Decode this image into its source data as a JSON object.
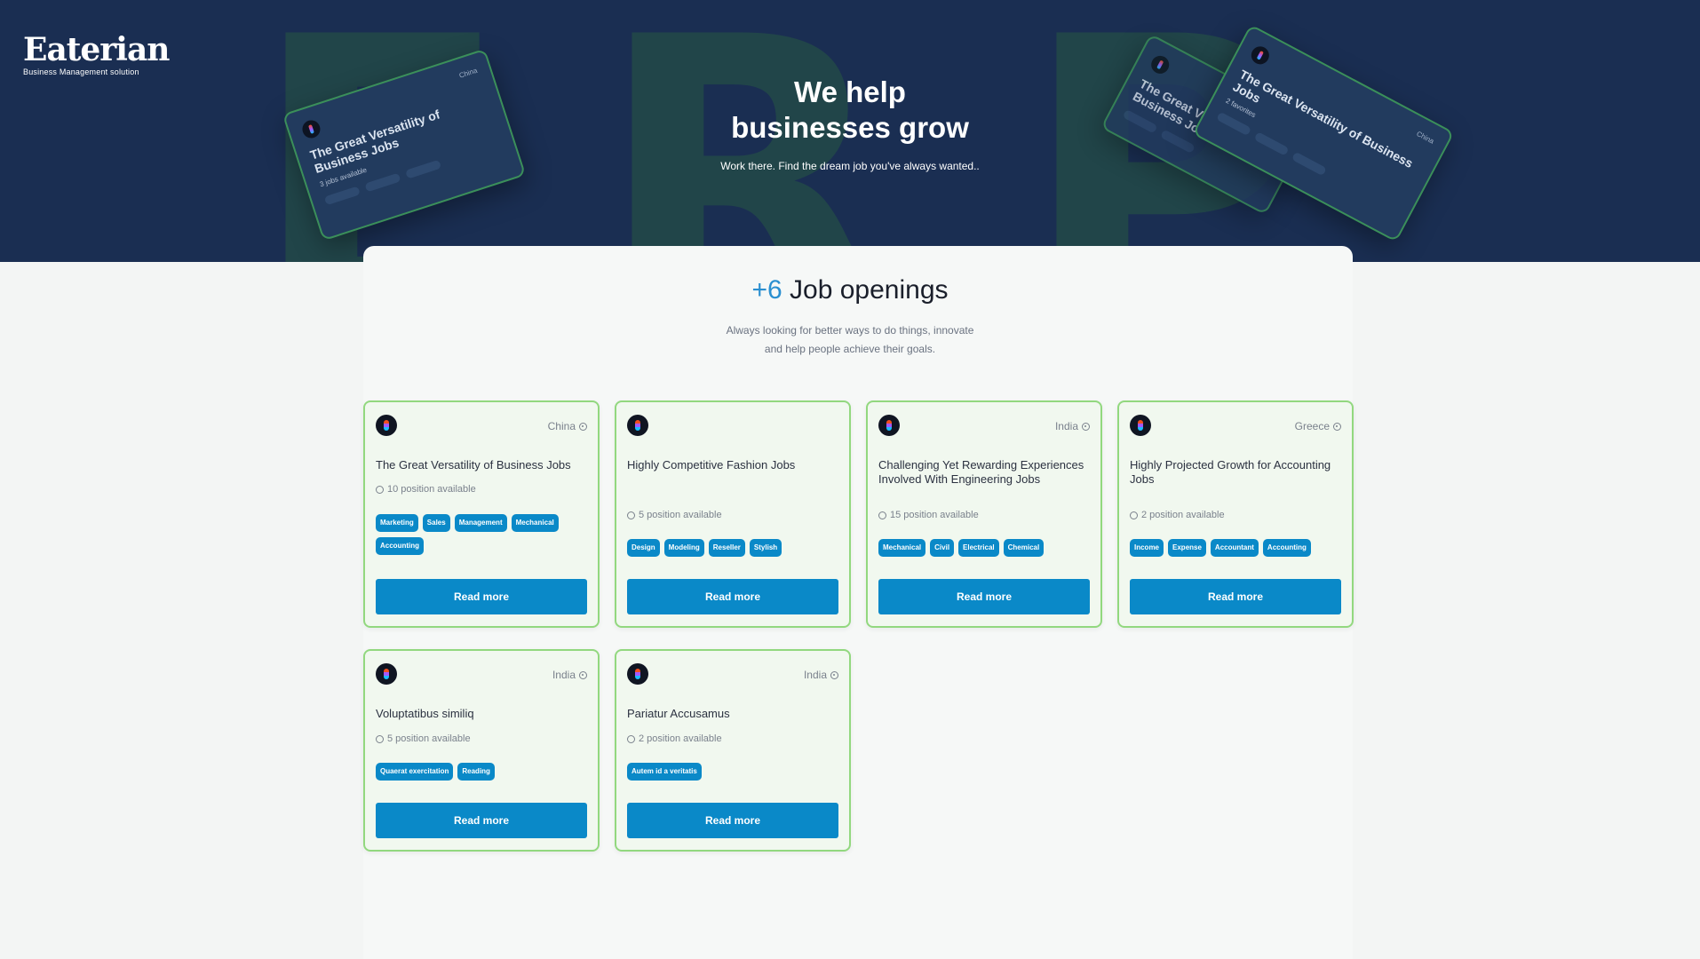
{
  "brand": {
    "name": "Eaterian",
    "tagline": "Business Management solution"
  },
  "hero": {
    "title_line1": "We help",
    "title_line2": "businesses grow",
    "subtitle": "Work there. Find the dream job you've always wanted..",
    "background_letters": [
      "E",
      "R",
      "P"
    ]
  },
  "decor_card": {
    "title": "The Great Versatility of Business Jobs",
    "location": "China",
    "positions": "3 jobs available",
    "favorites": "2 favorites"
  },
  "openings": {
    "count": "+6",
    "title": "Job openings",
    "subtitle_line1": "Always looking for better ways to do things, innovate",
    "subtitle_line2": "and help people achieve their goals."
  },
  "jobs": [
    {
      "title": "The Great Versatility of Business Jobs",
      "location": "China",
      "positions": "10 position available",
      "tags": [
        "Marketing",
        "Sales",
        "Management",
        "Mechanical",
        "Accounting"
      ],
      "button": "Read more"
    },
    {
      "title": "Highly Competitive Fashion Jobs",
      "location": "",
      "positions": "5 position available",
      "tags": [
        "Design",
        "Modeling",
        "Reseller",
        "Stylish"
      ],
      "button": "Read more"
    },
    {
      "title": "Challenging Yet Rewarding Experiences Involved With Engineering Jobs",
      "location": "India",
      "positions": "15 position available",
      "tags": [
        "Mechanical",
        "Civil",
        "Electrical",
        "Chemical"
      ],
      "button": "Read more"
    },
    {
      "title": "Highly Projected Growth for Accounting Jobs",
      "location": "Greece",
      "positions": "2 position available",
      "tags": [
        "Income",
        "Expense",
        "Accountant",
        "Accounting"
      ],
      "button": "Read more"
    },
    {
      "title": "Voluptatibus similiq",
      "location": "India",
      "positions": "5 position available",
      "tags": [
        "Quaerat exercitation",
        "Reading"
      ],
      "button": "Read more"
    },
    {
      "title": "Pariatur Accusamus",
      "location": "India",
      "positions": "2 position available",
      "tags": [
        "Autem id a veritatis"
      ],
      "button": "Read more"
    }
  ],
  "colors": {
    "hero_bg": "#1a2e52",
    "accent": "#2a8fd0",
    "button": "#0a89c8",
    "card_border": "#92d87f",
    "card_bg": "#f1f8ef"
  }
}
